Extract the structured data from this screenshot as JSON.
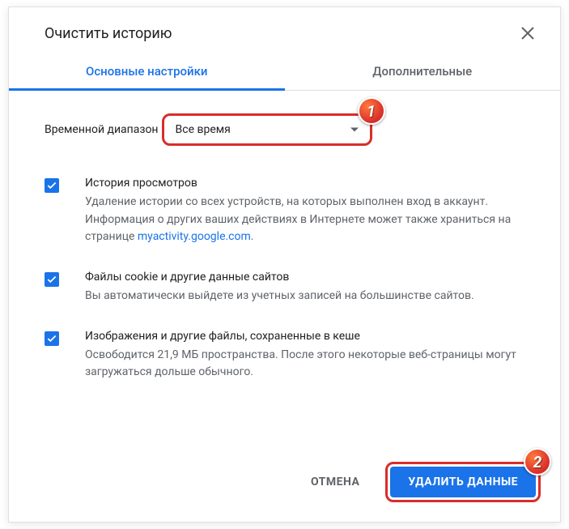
{
  "dialog": {
    "title": "Очистить историю"
  },
  "tabs": {
    "basic": "Основные настройки",
    "advanced": "Дополнительные"
  },
  "timeRange": {
    "label": "Временной диапазон",
    "value": "Все время"
  },
  "options": {
    "browsing": {
      "title": "История просмотров",
      "desc_prefix": "Удаление истории со всех устройств, на которых выполнен вход в аккаунт. Информация о других ваших действиях в Интернете может также храниться на странице ",
      "link": "myactivity.google.com",
      "desc_suffix": "."
    },
    "cookies": {
      "title": "Файлы cookie и другие данные сайтов",
      "desc": "Вы автоматически выйдете из учетных записей на большинстве сайтов."
    },
    "cache": {
      "title": "Изображения и другие файлы, сохраненные в кеше",
      "desc": "Освободится 21,9 МБ пространства. После этого некоторые веб-страницы могут загружаться дольше обычного."
    }
  },
  "buttons": {
    "cancel": "ОТМЕНА",
    "delete": "УДАЛИТЬ ДАННЫЕ"
  },
  "badges": {
    "one": "1",
    "two": "2"
  }
}
